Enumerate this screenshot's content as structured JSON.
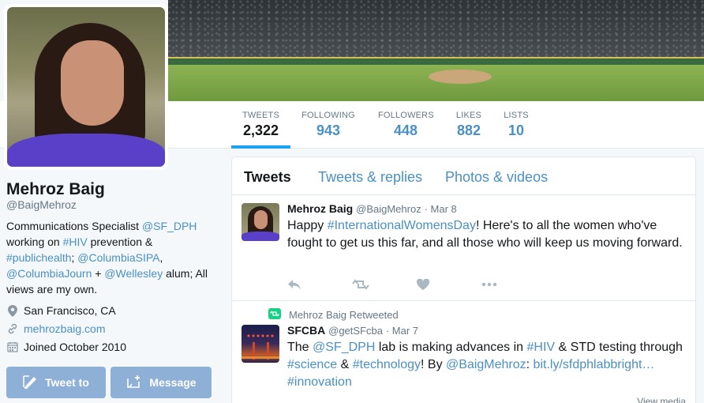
{
  "profile": {
    "name": "Mehroz Baig",
    "handle": "@BaigMehroz",
    "bio_parts": {
      "p1": "Communications Specialist ",
      "sfdph": "@SF_DPH",
      "p2": " working on ",
      "hiv": "#HIV",
      "p3": " prevention & ",
      "ph": "#publichealth",
      "p4": "; ",
      "sipa": "@ColumbiaSIPA",
      "p5": ", ",
      "journ": "@ColumbiaJourn",
      "p6": " + ",
      "wellesley": "@Wellesley",
      "p7": " alum; All views are my own."
    },
    "location": "San Francisco, CA",
    "website": "mehrozbaig.com",
    "joined": "Joined October 2010",
    "tweet_to_label": "Tweet to",
    "message_label": "Message"
  },
  "stats": [
    {
      "label": "TWEETS",
      "value": "2,322"
    },
    {
      "label": "FOLLOWING",
      "value": "943"
    },
    {
      "label": "FOLLOWERS",
      "value": "448"
    },
    {
      "label": "LIKES",
      "value": "882"
    },
    {
      "label": "LISTS",
      "value": "10"
    }
  ],
  "tabs": [
    "Tweets",
    "Tweets & replies",
    "Photos & videos"
  ],
  "tweets": [
    {
      "name": "Mehroz Baig",
      "handle": "@BaigMehroz",
      "date": "· Mar 8",
      "t1": "Happy ",
      "tag": "#InternationalWomensDay",
      "t2": "! Here's to all the women who've fought to get us this far, and all those who will keep us moving forward."
    },
    {
      "retweet_note": "Mehroz Baig Retweeted",
      "name": "SFCBA",
      "handle": "@getSFcba",
      "date": "· Mar 7",
      "t1": "The ",
      "sfdph": "@SF_DPH",
      "t2": " lab is making advances in ",
      "hiv": "#HIV",
      "t3": " & STD testing through ",
      "science": "#science",
      "t4": " & ",
      "tech": "#technology",
      "t5": "! By ",
      "baig": "@BaigMehroz",
      "t6": ": ",
      "url": "bit.ly/sfdphlabbright…",
      "t7": " ",
      "innov": "#innovation",
      "view_media": "View media"
    }
  ],
  "colors": {
    "accent": "#1da1f2",
    "link": "#4a90c4",
    "button": "#8fb0d6"
  }
}
